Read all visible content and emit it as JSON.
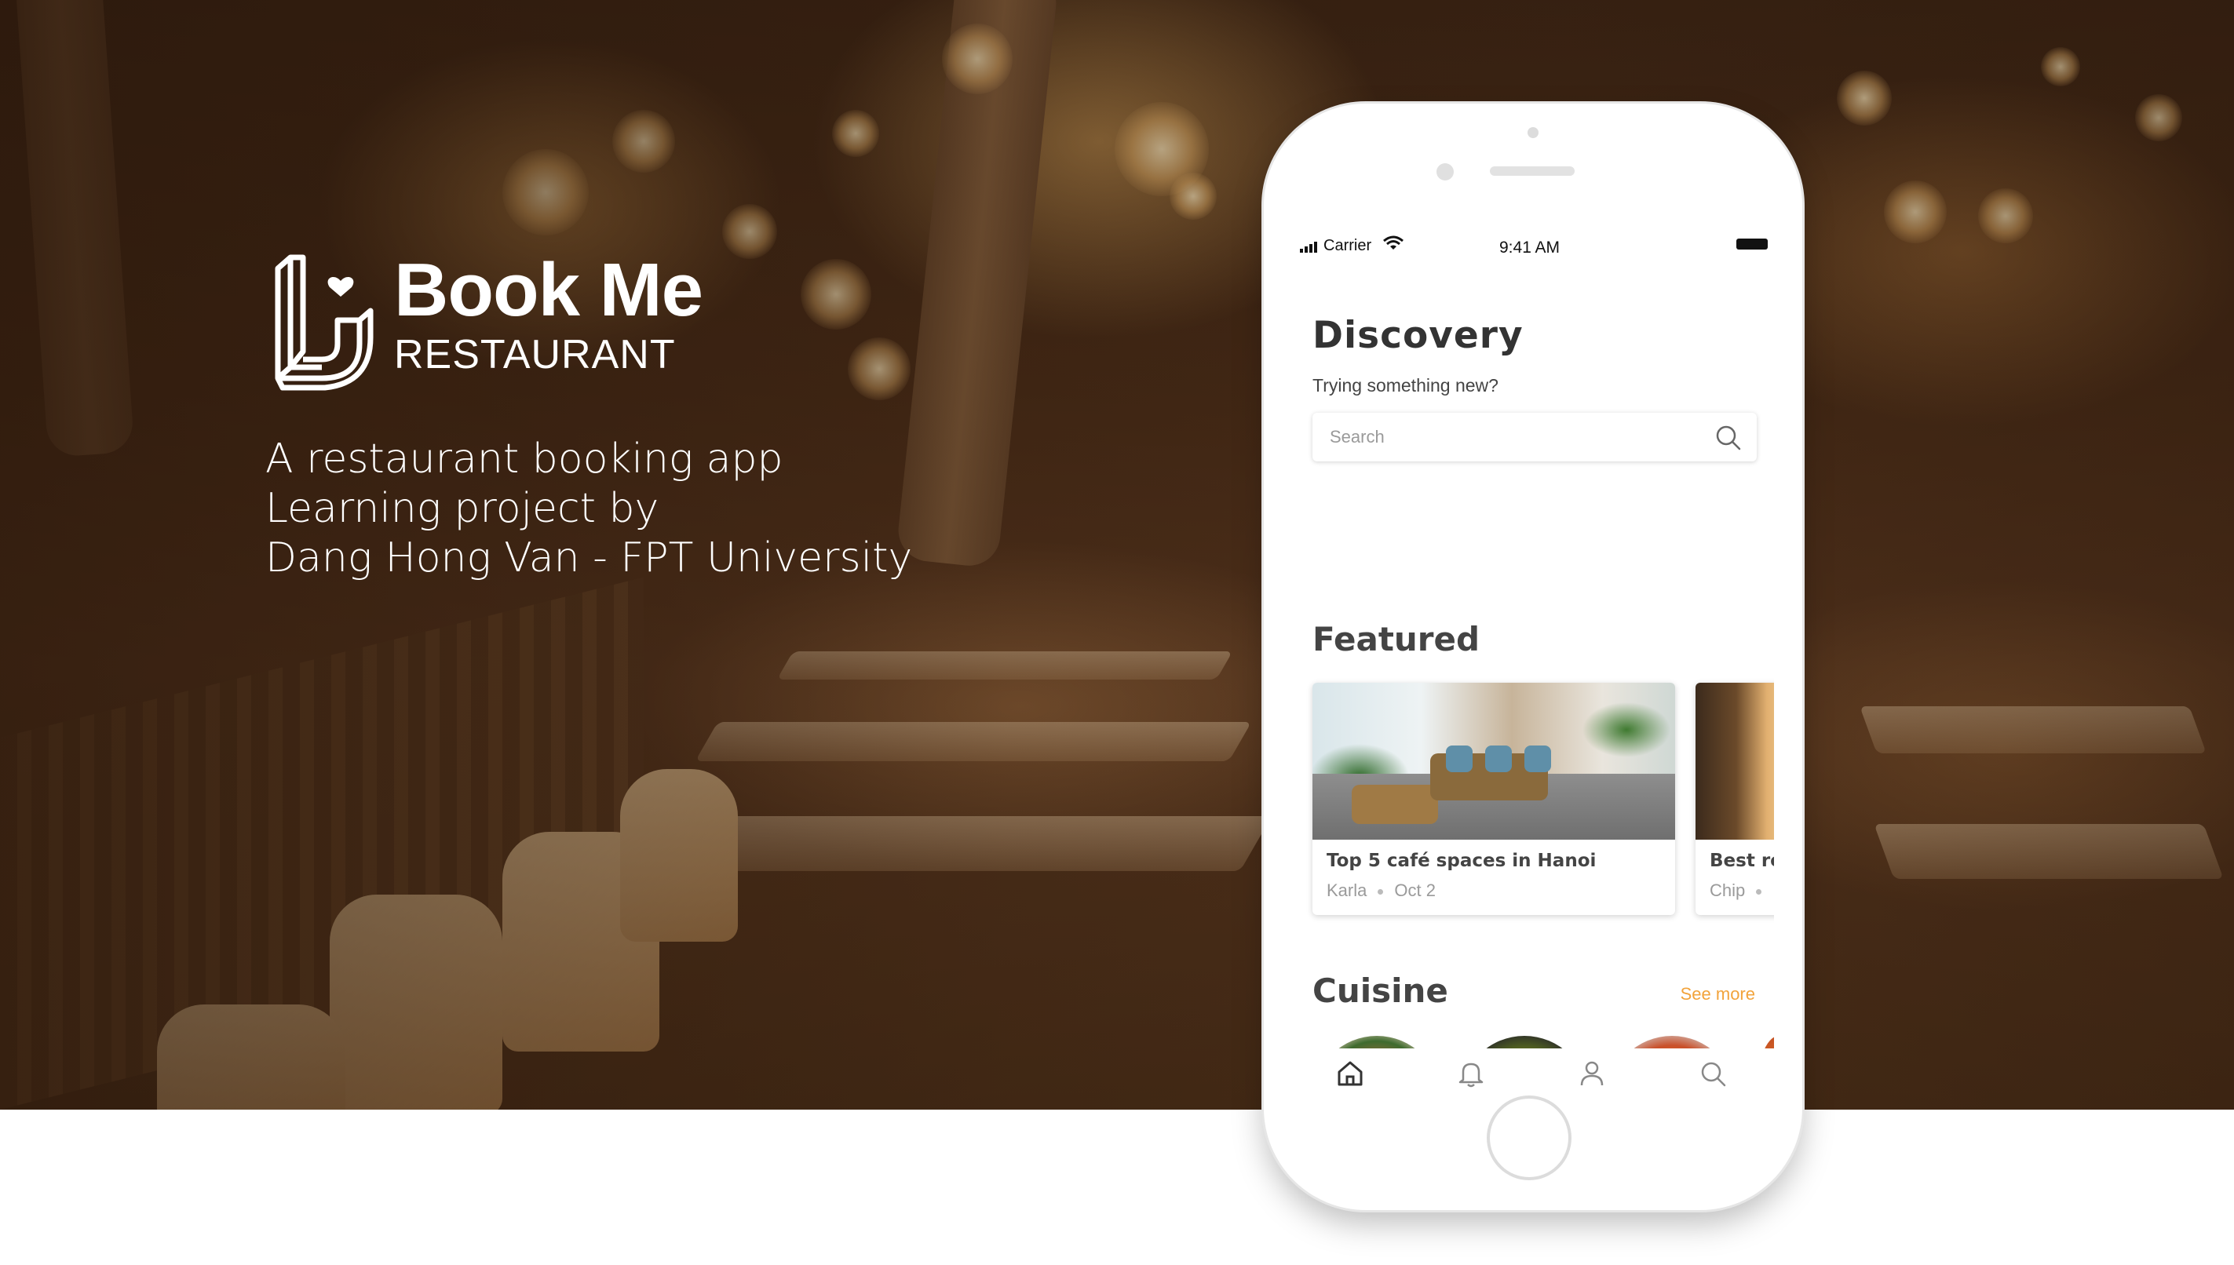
{
  "brand": {
    "name": "Book Me",
    "subtitle": "RESTAURANT"
  },
  "tagline": [
    "A restaurant booking app",
    "Learning project by",
    "Dang Hong Van - FPT University"
  ],
  "status_bar": {
    "carrier": "Carrier",
    "time": "9:41 AM"
  },
  "discovery": {
    "title": "Discovery",
    "subtitle": "Trying something new?"
  },
  "search": {
    "placeholder": "Search"
  },
  "featured": {
    "title": "Featured",
    "cards": [
      {
        "title": "Top 5 café spaces in Hanoi",
        "author": "Karla",
        "date": "Oct 2"
      },
      {
        "title": "Best re",
        "author": "Chip",
        "date": ""
      }
    ]
  },
  "cuisine": {
    "title": "Cuisine",
    "see_more": "See more"
  },
  "tabbar": {
    "items": [
      "home-icon",
      "bell-icon",
      "user-icon",
      "search-icon"
    ]
  },
  "colors": {
    "accent": "#f2a33b",
    "heading": "#333333",
    "muted": "#9a9a9a"
  }
}
